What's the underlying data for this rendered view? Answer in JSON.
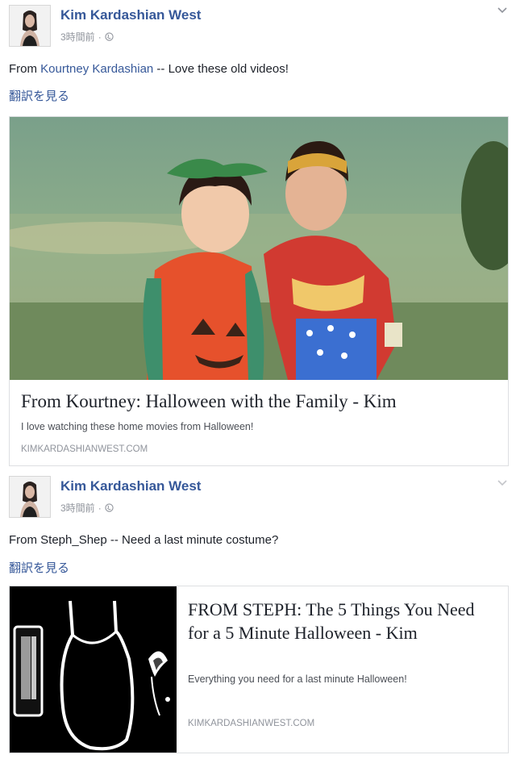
{
  "posts": [
    {
      "author": "Kim Kardashian West",
      "time": "3時間前",
      "separator": "·",
      "status_prefix": "From ",
      "status_mention": "Kourtney Kardashian",
      "status_suffix": " -- Love these old videos!",
      "translate_link": "翻訳を見る",
      "link": {
        "title": "From Kourtney: Halloween with the Family - Kim",
        "description": "I love watching these home movies from Halloween!",
        "domain": "KIMKARDASHIANWEST.COM"
      },
      "icons": {
        "privacy": "globe-icon",
        "menu": "chevron-down-icon"
      }
    },
    {
      "author": "Kim Kardashian West",
      "time": "3時間前",
      "separator": "·",
      "status": "From Steph_Shep -- Need a last minute costume?",
      "translate_link": "翻訳を見る",
      "link": {
        "title": "FROM STEPH: The 5 Things You Need for a 5 Minute Halloween - Kim",
        "description": "Everything you need for a last minute Halloween!",
        "domain": "KIMKARDASHIANWEST.COM"
      },
      "icons": {
        "privacy": "globe-icon",
        "menu": "chevron-down-icon"
      }
    }
  ],
  "colors": {
    "link_blue": "#365899",
    "meta_gray": "#90949c",
    "border": "#dddfe2"
  }
}
